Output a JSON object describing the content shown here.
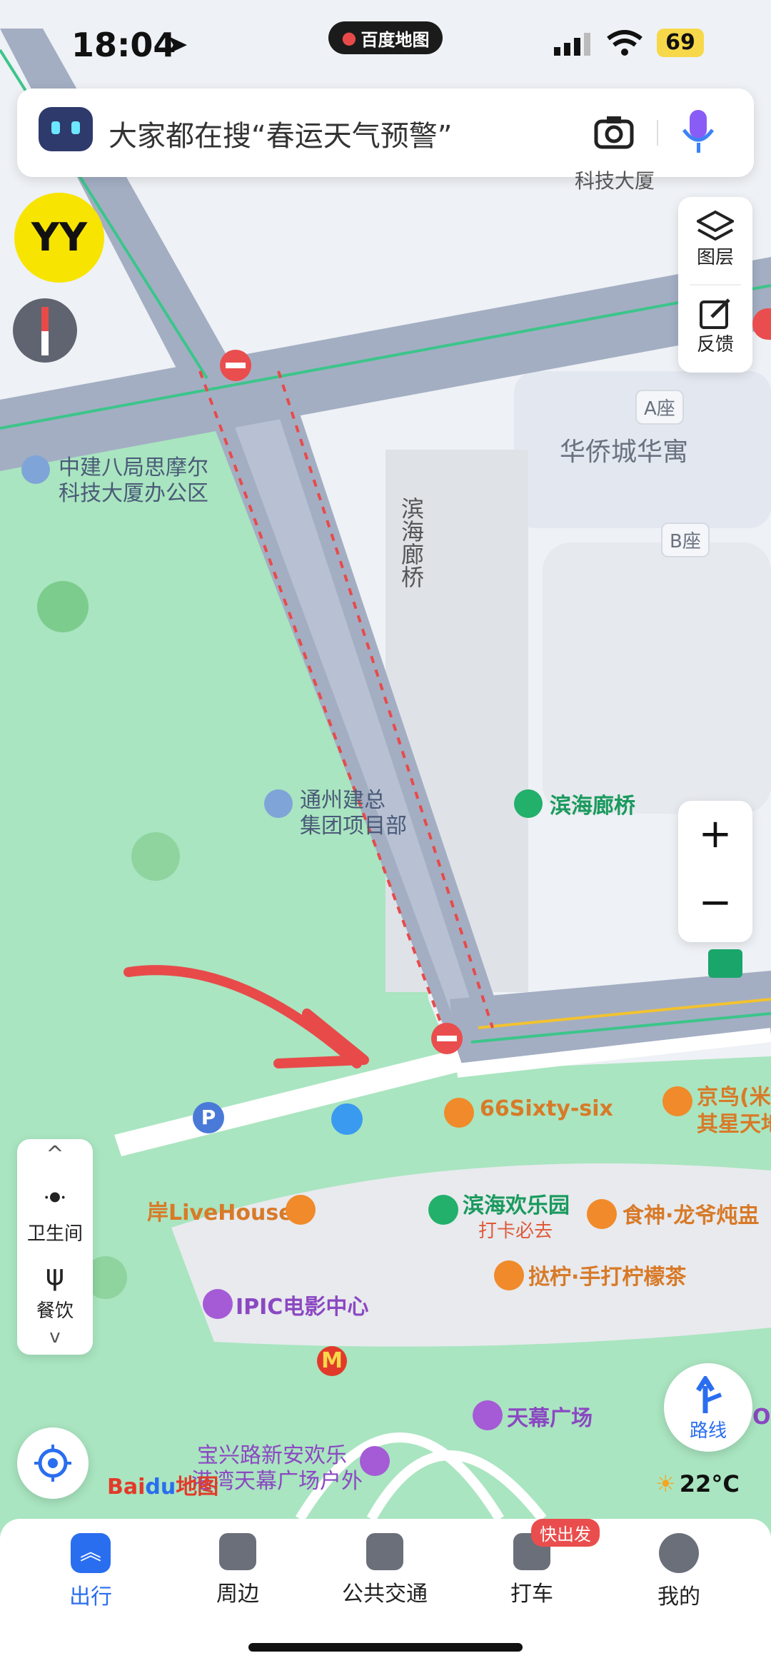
{
  "status_bar": {
    "time": "18:04",
    "app_badge": "百度地图",
    "battery": "69"
  },
  "search": {
    "placeholder": "大家都在搜“春运天气预警”"
  },
  "side_controls": {
    "layers_label": "图层",
    "feedback_label": "反馈",
    "zoom_in": "+",
    "zoom_out": "−"
  },
  "map_labels": {
    "building_a": "A座",
    "building_b": "B座",
    "huaqiao": "华侨城华寓",
    "bridge_vertical": "滨海廊桥",
    "keji_top": "科技大厦",
    "zhongjian_line1": "中建八局思摩尔",
    "zhongjian_line2": "科技大厦办公区",
    "tongzhou_line1": "通州建总",
    "tongzhou_line2": "集团项目部",
    "binhai_bridge": "滨海廊桥",
    "sixty_six": "66Sixty-six",
    "jingniao_line1": "京鸟(米",
    "jingniao_line2": "其星天地",
    "livehouse": "岸LiveHouse",
    "binhai_park": "滨海欢乐园",
    "binhai_park_sub": "打卡必去",
    "shishen": "食神·龙爷炖盅",
    "lemon_tea": "挞柠·手打柠檬茶",
    "ipic": "IPIC电影中心",
    "tianmu": "天幕广场",
    "baoxing_line1": "宝兴路新安欢乐",
    "baoxing_line2": "港湾天幕广场户外",
    "edge_o": "O"
  },
  "filters": {
    "toilet": "卫生间",
    "food": "餐饮"
  },
  "route_button": "路线",
  "weather": {
    "temp": "22°C"
  },
  "logo": {
    "bai": "Bai",
    "du": "du",
    "map": "地图"
  },
  "tabs": [
    {
      "label": "出行",
      "active": true
    },
    {
      "label": "周边"
    },
    {
      "label": "公共交通"
    },
    {
      "label": "打车",
      "badge": "快出发"
    },
    {
      "label": "我的"
    }
  ],
  "colors": {
    "accent": "#2a6ef0",
    "park": "#a8e6bf",
    "road": "#9aa7bd",
    "route_mark": "#e84a4a"
  }
}
